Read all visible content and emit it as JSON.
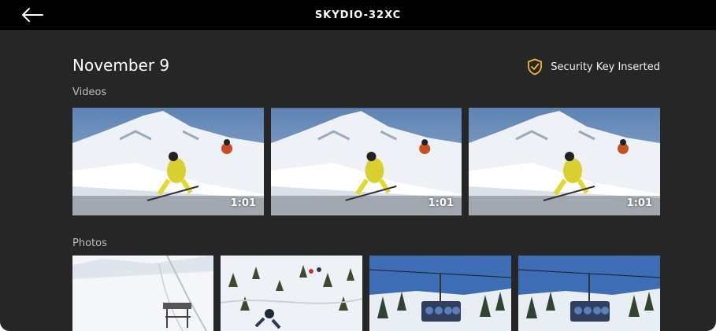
{
  "header": {
    "title": "SKYDIO-32XC"
  },
  "content": {
    "date": "November 9",
    "security_status": "Security Key Inserted",
    "accent_color": "#F5B82E",
    "videos": {
      "label": "Videos",
      "items": [
        {
          "duration": "1:01"
        },
        {
          "duration": "1:01"
        },
        {
          "duration": "1:01"
        }
      ]
    },
    "photos": {
      "label": "Photos",
      "items": [
        {
          "subject": "ski-slope"
        },
        {
          "subject": "skier-in-trees"
        },
        {
          "subject": "chairlift"
        },
        {
          "subject": "chairlift"
        }
      ]
    }
  }
}
